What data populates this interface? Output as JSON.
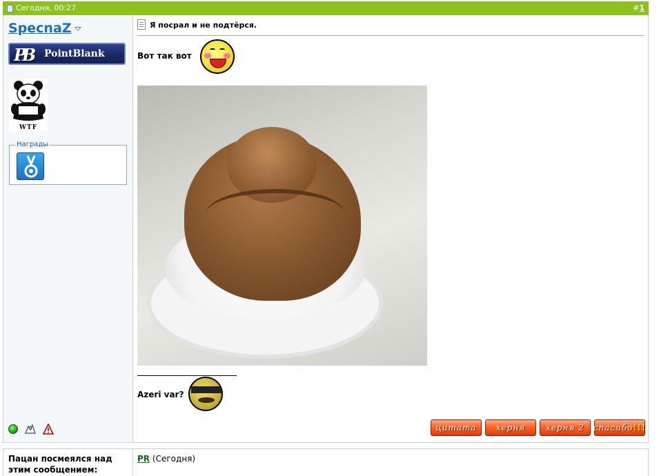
{
  "post": {
    "date": "Сегодня, 00:27",
    "number_prefix": "#",
    "number": "1",
    "title": "Я посрал и не подтёрся.",
    "body_line1": "Вот так вот",
    "signature_text": "Azeri var?"
  },
  "user": {
    "name": "SpecnaZ",
    "rank_text": "PointBlank",
    "avatar_text": "WTF",
    "awards_legend": "Награды"
  },
  "buttons": {
    "quote": "цитата",
    "xernya": "херня",
    "xernya2_text": "херня",
    "xernya2_num": "2",
    "thanks_text": "спасибо",
    "thanks_bang": "!!!"
  },
  "thanks": {
    "label": "Пацан посмеялся над этим сообщением:",
    "user": "PR",
    "when": "(Сегодня)"
  },
  "colors": {
    "header_bg": "#8cc21f",
    "username": "#1a6fbf",
    "button": "#ff6a2c",
    "thanks_user": "#0b6b1f"
  }
}
